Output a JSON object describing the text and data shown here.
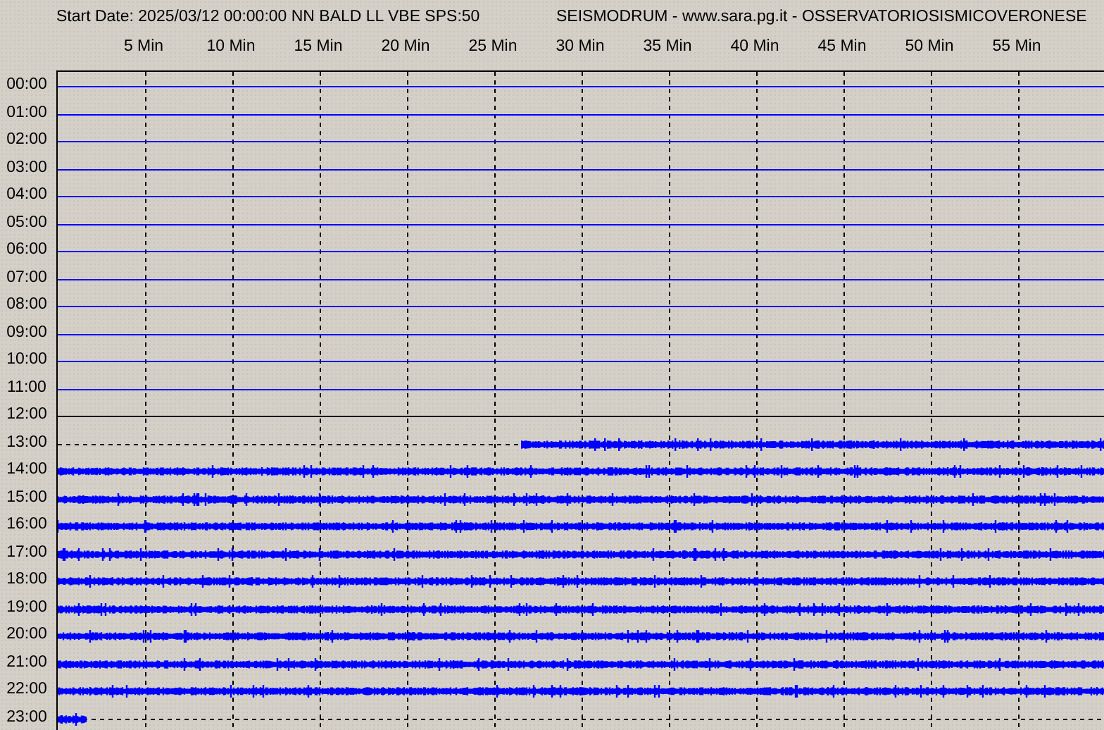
{
  "header": {
    "station": "Start Date: 2025/03/12 00:00:00 NN BALD LL VBE SPS:50",
    "title": "SEISMODRUM - www.sara.pg.it - OSSERVATORIOSISMICOVERONESE"
  },
  "time_axis": [
    "5 Min",
    "10 Min",
    "15 Min",
    "20 Min",
    "25 Min",
    "30 Min",
    "35 Min",
    "40 Min",
    "45 Min",
    "50 Min",
    "55 Min"
  ],
  "rows": [
    {
      "label": "00:00",
      "kind": "flat"
    },
    {
      "label": "01:00",
      "kind": "flat"
    },
    {
      "label": "02:00",
      "kind": "flat"
    },
    {
      "label": "03:00",
      "kind": "flat"
    },
    {
      "label": "04:00",
      "kind": "flat"
    },
    {
      "label": "05:00",
      "kind": "flat"
    },
    {
      "label": "06:00",
      "kind": "flat"
    },
    {
      "label": "07:00",
      "kind": "flat"
    },
    {
      "label": "08:00",
      "kind": "flat"
    },
    {
      "label": "09:00",
      "kind": "flat"
    },
    {
      "label": "10:00",
      "kind": "flat"
    },
    {
      "label": "11:00",
      "kind": "flat"
    },
    {
      "label": "12:00",
      "kind": "blank"
    },
    {
      "label": "13:00",
      "kind": "late_trace",
      "level": 0.557
    },
    {
      "label": "14:00",
      "kind": "trace",
      "level": 1
    },
    {
      "label": "15:00",
      "kind": "trace",
      "level": 1
    },
    {
      "label": "16:00",
      "kind": "trace",
      "level": 1
    },
    {
      "label": "17:00",
      "kind": "trace",
      "level": 1
    },
    {
      "label": "18:00",
      "kind": "trace",
      "level": 1
    },
    {
      "label": "19:00",
      "kind": "trace",
      "level": 1
    },
    {
      "label": "20:00",
      "kind": "trace",
      "level": 1
    },
    {
      "label": "21:00",
      "kind": "trace",
      "level": 1
    },
    {
      "label": "22:00",
      "kind": "trace",
      "level": 1
    },
    {
      "label": "23:00",
      "kind": "trace",
      "level": 0.028
    }
  ]
}
